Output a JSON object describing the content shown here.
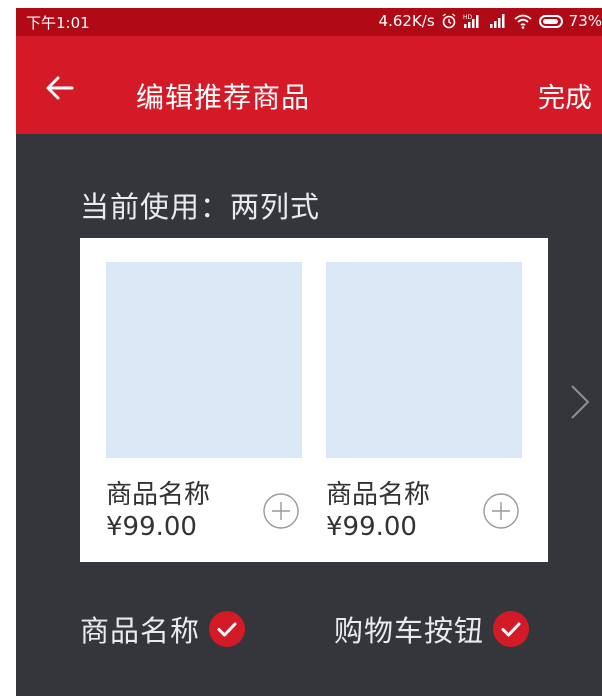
{
  "status_bar": {
    "time": "下午1:01",
    "network_speed": "4.62K/s",
    "icons": [
      "alarm-icon",
      "hd-signal-icon",
      "signal-icon",
      "wifi-icon",
      "battery-icon"
    ],
    "battery": "73%"
  },
  "app_bar": {
    "title": "编辑推荐商品",
    "done_label": "完成",
    "color": "#d51a27"
  },
  "current_layout": "当前使用：两列式",
  "products": [
    {
      "name": "商品名称",
      "price": "¥99.00"
    },
    {
      "name": "商品名称",
      "price": "¥99.00"
    }
  ],
  "options": [
    {
      "label": "商品名称",
      "checked": true
    },
    {
      "label": "购物车按钮",
      "checked": true
    }
  ],
  "colors": {
    "background": "#34363c",
    "accent": "#d51a27",
    "image_placeholder": "#dbe9f7"
  }
}
